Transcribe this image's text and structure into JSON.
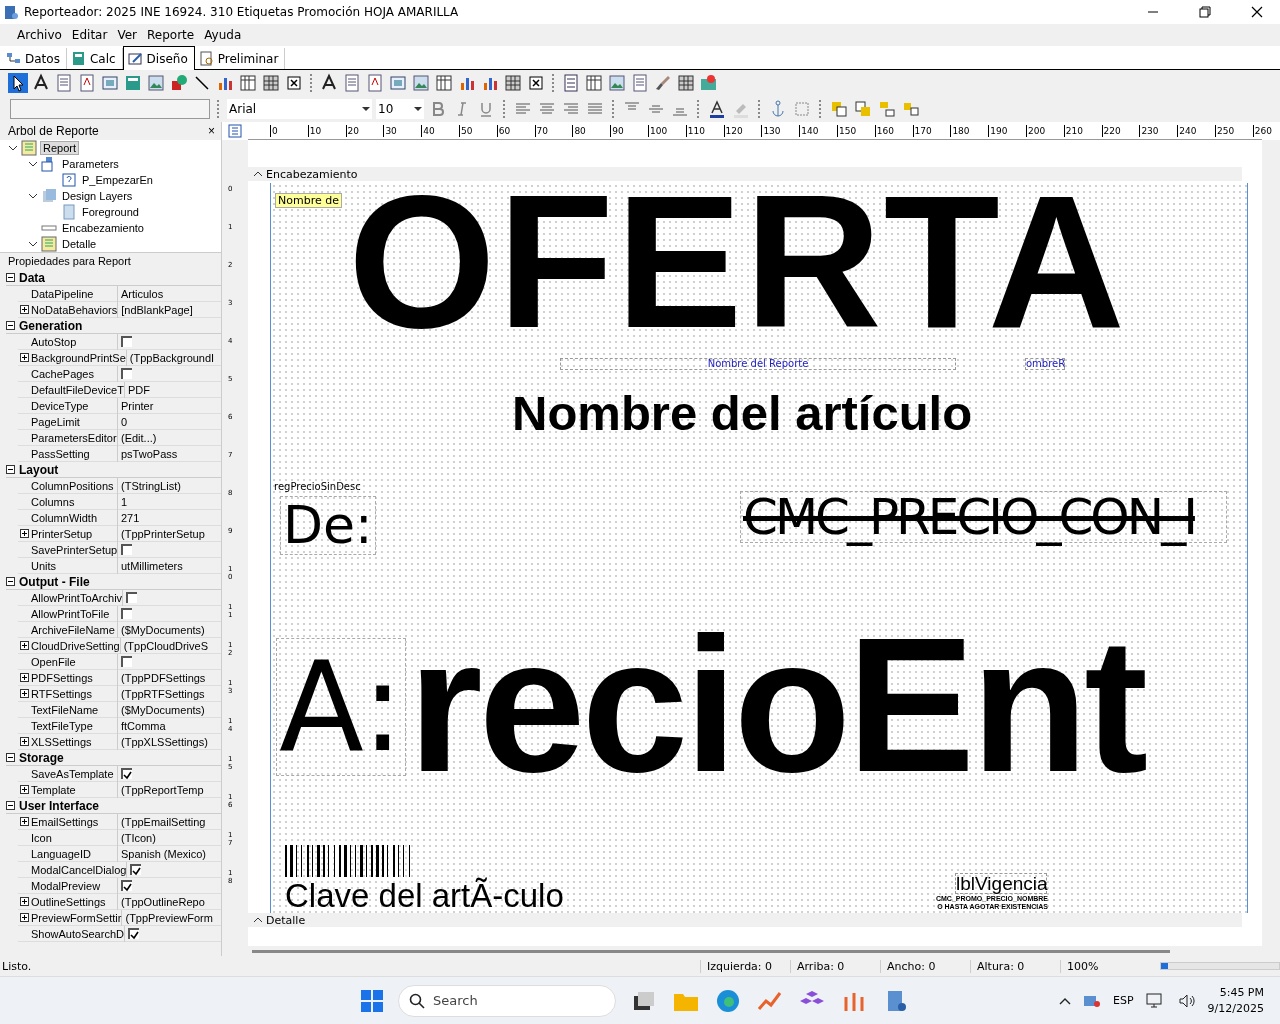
{
  "window": {
    "title": "Reporteador: 2025 INE 16924. 310 Etiquetas Promoción HOJA AMARILLA"
  },
  "menu": [
    "Archivo",
    "Editar",
    "Ver",
    "Reporte",
    "Ayuda"
  ],
  "tabs": [
    {
      "label": "Datos",
      "selected": false
    },
    {
      "label": "Calc",
      "selected": false
    },
    {
      "label": "Diseño",
      "selected": true
    },
    {
      "label": "Preliminar",
      "selected": false
    }
  ],
  "format_bar": {
    "font": "Arial",
    "size": "10"
  },
  "tree": {
    "title": "Arbol de Reporte",
    "close": "×",
    "items": [
      {
        "label": "Report",
        "selected": true,
        "expanded": true,
        "children": [
          {
            "label": "Parameters",
            "selected": false,
            "expanded": true,
            "children": [
              {
                "label": "P_EmpezarEn",
                "selected": false
              }
            ]
          },
          {
            "label": "Design Layers",
            "selected": false,
            "expanded": true,
            "children": [
              {
                "label": "Foreground",
                "selected": false
              }
            ]
          },
          {
            "label": "Encabezamiento",
            "selected": false
          },
          {
            "label": "Detalle",
            "selected": false,
            "expanded": true
          }
        ]
      }
    ]
  },
  "properties": {
    "title": "Propiedades para Report",
    "groups": [
      {
        "name": "Data",
        "rows": [
          {
            "name": "DataPipeline",
            "value": "Articulos",
            "expandable": false
          },
          {
            "name": "NoDataBehaviors",
            "value": "[ndBlankPage]",
            "expandable": true
          }
        ]
      },
      {
        "name": "Generation",
        "rows": [
          {
            "name": "AutoStop",
            "checked": false,
            "expandable": false
          },
          {
            "name": "BackgroundPrintSe",
            "value": "(TppBackgroundI",
            "expandable": true
          },
          {
            "name": "CachePages",
            "checked": false,
            "expandable": false
          },
          {
            "name": "DefaultFileDeviceT",
            "value": "PDF",
            "expandable": false
          },
          {
            "name": "DeviceType",
            "value": "Printer",
            "expandable": false
          },
          {
            "name": "PageLimit",
            "value": "0",
            "expandable": false
          },
          {
            "name": "ParametersEditor",
            "value": "(Edit...)",
            "expandable": false
          },
          {
            "name": "PassSetting",
            "value": "psTwoPass",
            "expandable": false
          }
        ]
      },
      {
        "name": "Layout",
        "rows": [
          {
            "name": "ColumnPositions",
            "value": "(TStringList)",
            "expandable": false
          },
          {
            "name": "Columns",
            "value": "1",
            "expandable": false
          },
          {
            "name": "ColumnWidth",
            "value": "271",
            "expandable": false
          },
          {
            "name": "PrinterSetup",
            "value": "(TppPrinterSetup",
            "expandable": true
          },
          {
            "name": "SavePrinterSetup",
            "checked": false,
            "expandable": false
          },
          {
            "name": "Units",
            "value": "utMillimeters",
            "expandable": false
          }
        ]
      },
      {
        "name": "Output - File",
        "rows": [
          {
            "name": "AllowPrintToArchiv",
            "checked": false,
            "expandable": false
          },
          {
            "name": "AllowPrintToFile",
            "checked": false,
            "expandable": false
          },
          {
            "name": "ArchiveFileName",
            "value": "($MyDocuments)",
            "expandable": false
          },
          {
            "name": "CloudDriveSetting",
            "value": "(TppCloudDriveS",
            "expandable": true
          },
          {
            "name": "OpenFile",
            "checked": false,
            "expandable": false
          },
          {
            "name": "PDFSettings",
            "value": "(TppPDFSettings",
            "expandable": true
          },
          {
            "name": "RTFSettings",
            "value": "(TppRTFSettings",
            "expandable": true
          },
          {
            "name": "TextFileName",
            "value": "($MyDocuments)",
            "expandable": false
          },
          {
            "name": "TextFileType",
            "value": "ftComma",
            "expandable": false
          },
          {
            "name": "XLSSettings",
            "value": "(TppXLSSettings)",
            "expandable": true
          }
        ]
      },
      {
        "name": "Storage",
        "rows": [
          {
            "name": "SaveAsTemplate",
            "checked": true,
            "expandable": false
          },
          {
            "name": "Template",
            "value": "(TppReportTemp",
            "expandable": true
          }
        ]
      },
      {
        "name": "User Interface",
        "rows": [
          {
            "name": "EmailSettings",
            "value": "(TppEmailSetting",
            "expandable": true
          },
          {
            "name": "Icon",
            "value": "(TIcon)",
            "expandable": false
          },
          {
            "name": "LanguageID",
            "value": "Spanish (Mexico)",
            "expandable": false
          },
          {
            "name": "ModalCancelDialog",
            "checked": true,
            "expandable": false
          },
          {
            "name": "ModalPreview",
            "checked": true,
            "expandable": false
          },
          {
            "name": "OutlineSettings",
            "value": "(TppOutlineRepo",
            "expandable": true
          },
          {
            "name": "PreviewFormSettir",
            "value": "(TppPreviewForm",
            "expandable": true
          },
          {
            "name": "ShowAutoSearchD",
            "checked": true,
            "expandable": false
          }
        ]
      }
    ]
  },
  "ruler": {
    "marks": [
      "0",
      "10",
      "20",
      "30",
      "40",
      "50",
      "60",
      "70",
      "80",
      "90",
      "100",
      "110",
      "120",
      "130",
      "140",
      "150",
      "160",
      "170",
      "180",
      "190",
      "200",
      "210",
      "220",
      "230",
      "240",
      "250",
      "260"
    ],
    "vertical_marks": [
      "0",
      "1",
      "2",
      "3",
      "4",
      "5",
      "6",
      "7",
      "8",
      "9",
      "10",
      "11",
      "12",
      "13",
      "14",
      "15",
      "16",
      "17",
      "18"
    ]
  },
  "bands": [
    {
      "label": "Encabezamiento"
    },
    {
      "label": "Detalle"
    }
  ],
  "canvas_objects": [
    {
      "kind": "label",
      "text": "Nombre de"
    },
    {
      "kind": "headline",
      "text": "OFERTA"
    },
    {
      "kind": "sysvar",
      "text": "Nombre del Reporte"
    },
    {
      "kind": "sysvar",
      "text": "ombreR"
    },
    {
      "kind": "title",
      "text": "Nombre del artículo"
    },
    {
      "kind": "small",
      "text": "regPrecioSinDesc"
    },
    {
      "kind": "condensed",
      "text": "De:"
    },
    {
      "kind": "strike",
      "text": "CMC_PRECIO_CON_I"
    },
    {
      "kind": "condensed",
      "text": "A:"
    },
    {
      "kind": "huge",
      "text": "recioEnt"
    },
    {
      "kind": "barcode"
    },
    {
      "kind": "plain",
      "text": "Clave del artÃ-culo"
    },
    {
      "kind": "vigencia",
      "text": "lblVigencia"
    },
    {
      "kind": "tiny",
      "text": "CMC_PROMO_PRECIO_NOMBRE"
    },
    {
      "kind": "tiny",
      "text": "O HASTA AGOTAR EXISTENCIAS"
    }
  ],
  "status_bar": {
    "message": "Listo.",
    "fields": [
      "Izquierda: 0",
      "Arriba: 0",
      "Ancho: 0",
      "Altura: 0"
    ],
    "zoom": "100%",
    "zoom_level": {
      "level": 0.06
    }
  },
  "taskbar": {
    "search": "Search",
    "language": "ESP",
    "time": "5:45 PM",
    "date": "9/12/2025"
  }
}
